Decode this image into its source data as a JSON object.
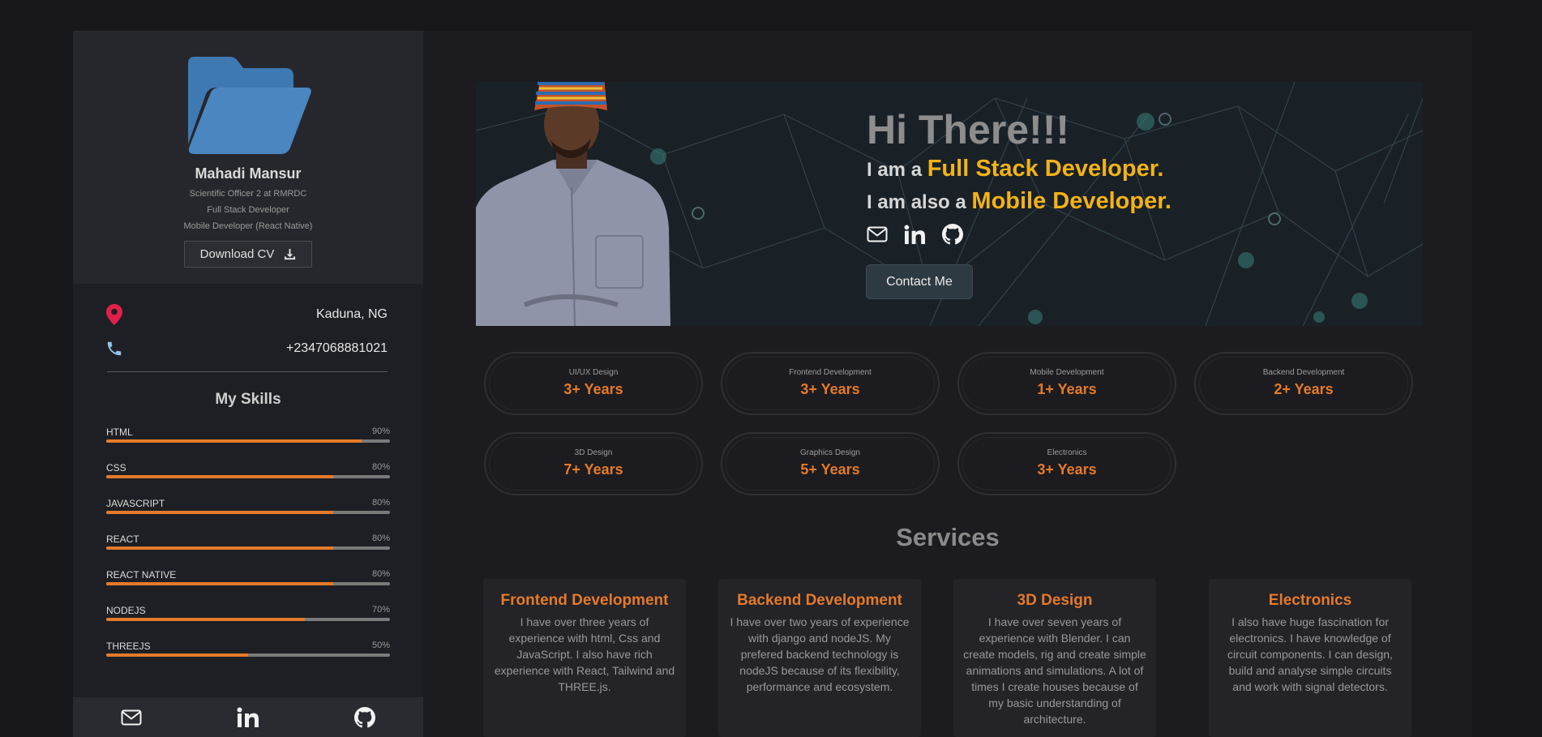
{
  "profile": {
    "name": "Mahadi Mansur",
    "role1": "Scientific Officer 2 at RMRDC",
    "role2": "Full Stack Developer",
    "role3": "Mobile Developer (React Native)",
    "download_label": "Download CV"
  },
  "contact": {
    "location": "Kaduna, NG",
    "phone": "+2347068881021"
  },
  "skills": {
    "title": "My Skills",
    "items": [
      {
        "name": "HTML",
        "pct_label": "90%",
        "level": 0.9
      },
      {
        "name": "CSS",
        "pct_label": "80%",
        "level": 0.8
      },
      {
        "name": "JAVASCRIPT",
        "pct_label": "80%",
        "level": 0.8
      },
      {
        "name": "REACT",
        "pct_label": "80%",
        "level": 0.8
      },
      {
        "name": "REACT NATIVE",
        "pct_label": "80%",
        "level": 0.8
      },
      {
        "name": "NODEJS",
        "pct_label": "70%",
        "level": 0.7
      },
      {
        "name": "THREEJS",
        "pct_label": "50%",
        "level": 0.5
      }
    ]
  },
  "hero": {
    "greeting": "Hi There!!!",
    "line1_prefix": "I am a ",
    "line1_highlight": "Full Stack Developer.",
    "line2_prefix": "I am also a ",
    "line2_highlight": "Mobile Developer.",
    "contact_label": "Contact Me"
  },
  "experience": [
    {
      "label": "UI/UX Design",
      "value": "3+ Years"
    },
    {
      "label": "Frontend Development",
      "value": "3+ Years"
    },
    {
      "label": "Mobile Development",
      "value": "1+ Years"
    },
    {
      "label": "Backend Development",
      "value": "2+ Years"
    },
    {
      "label": "3D Design",
      "value": "7+ Years"
    },
    {
      "label": "Graphics Design",
      "value": "5+ Years"
    },
    {
      "label": "Electronics",
      "value": "3+ Years"
    }
  ],
  "services": {
    "title": "Services",
    "items": [
      {
        "title": "Frontend Development",
        "text": "I have over three years of experience with html, Css and JavaScript. I also have rich experience with React, Tailwind and THREE.js."
      },
      {
        "title": "Backend Development",
        "text": "I have over two years of experience with django and nodeJS. My prefered backend technology is nodeJS because of its flexibility, performance and ecosystem."
      },
      {
        "title": "3D Design",
        "text": "I have over seven years of experience with Blender. I can create models, rig and create simple animations and simulations. A lot of times I create houses because of my basic understanding of architecture."
      },
      {
        "title": "Electronics",
        "text": "I also have huge fascination for electronics. I have knowledge of circuit components. I can design, build and analyse simple circuits and work with signal detectors."
      }
    ]
  },
  "colors": {
    "accent_orange": "#e57a2a",
    "accent_yellow": "#f2b218",
    "folder_blue": "#4a86c0",
    "pin_red": "#e0204a",
    "phone_blue": "#8fc3ec"
  },
  "icons": [
    "folder-icon",
    "download-icon",
    "location-pin-icon",
    "phone-icon",
    "mail-icon",
    "linkedin-icon",
    "github-icon"
  ]
}
